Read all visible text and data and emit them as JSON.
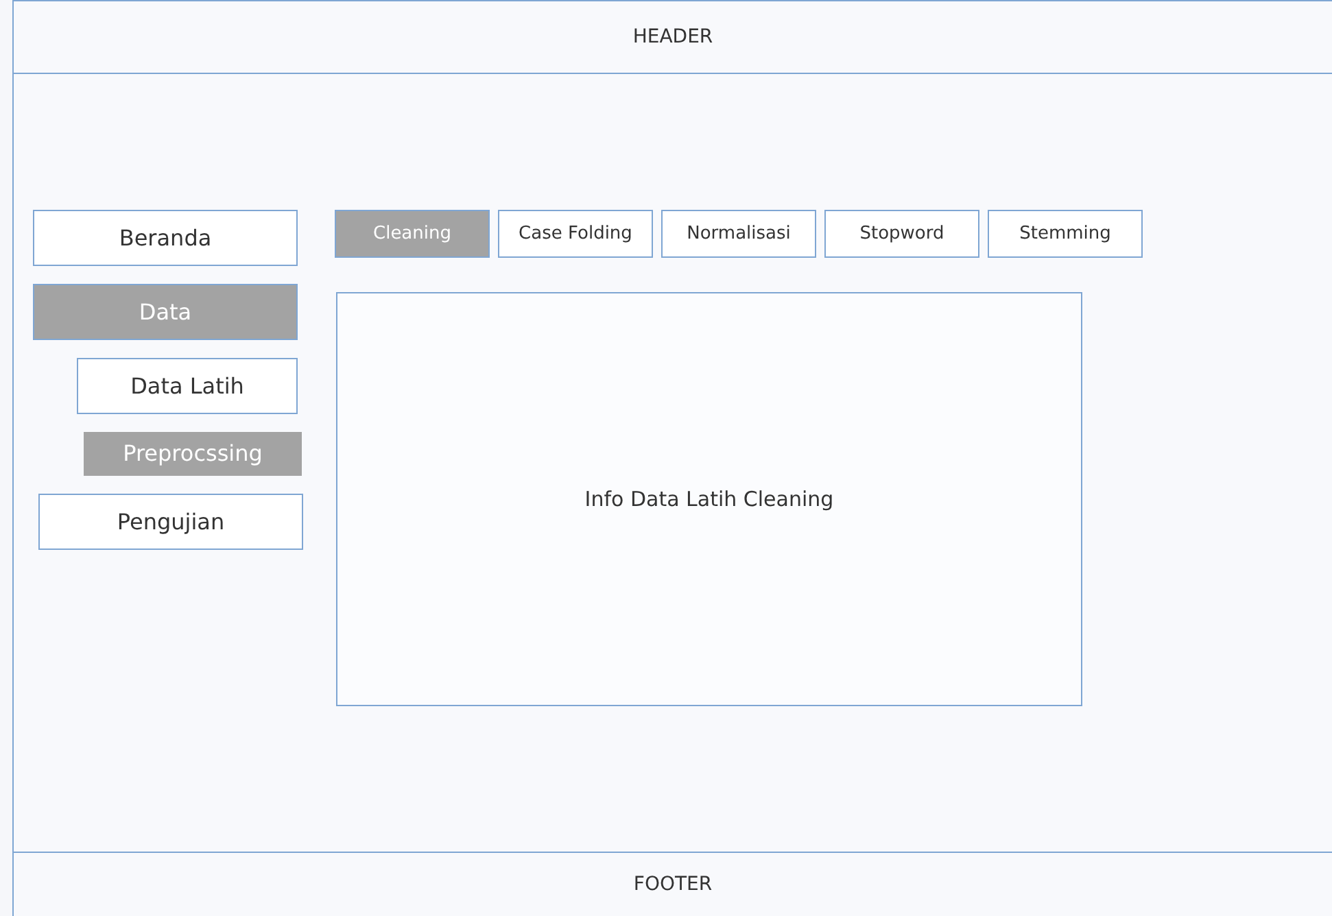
{
  "header": {
    "title": "HEADER"
  },
  "sidebar": {
    "items": [
      {
        "label": "Beranda",
        "selected": false
      },
      {
        "label": "Data",
        "selected": true,
        "children": [
          {
            "label": "Data Latih",
            "selected": false,
            "children": [
              {
                "label": "Preprocssing",
                "selected": true
              }
            ]
          }
        ]
      },
      {
        "label": "Pengujian",
        "selected": false
      }
    ]
  },
  "tabs": [
    {
      "label": "Cleaning",
      "selected": true
    },
    {
      "label": "Case Folding",
      "selected": false
    },
    {
      "label": "Normalisasi",
      "selected": false
    },
    {
      "label": "Stopword",
      "selected": false
    },
    {
      "label": "Stemming",
      "selected": false
    }
  ],
  "content": {
    "text": "Info Data Latih Cleaning"
  },
  "footer": {
    "title": "FOOTER"
  }
}
